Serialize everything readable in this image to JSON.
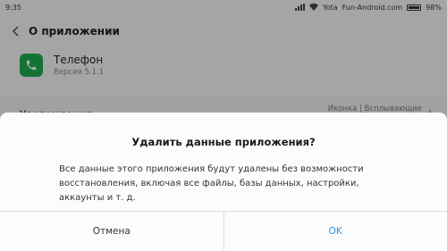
{
  "status_bar": {
    "time": "9:35",
    "carrier": "Yota",
    "site": "Fun-Android.com",
    "battery": "98%"
  },
  "header": {
    "title": "О приложении",
    "back_icon": "chevron-left-icon"
  },
  "app": {
    "name": "Телефон",
    "version": "Версия 5.1.1",
    "icon": "phone-icon",
    "icon_color": "#1ea94f"
  },
  "notifications_row": {
    "label": "Уведомления",
    "value": "Иконка | Всплывающие | Локскрин"
  },
  "dialog": {
    "title": "Удалить данные приложения?",
    "message": "Все данные этого приложения будут удалены без возможности восстановления, включая все файлы, базы данных, настройки, аккаунты и т. д.",
    "cancel_label": "Отмена",
    "ok_label": "OK",
    "ok_color": "#2a95e8"
  }
}
